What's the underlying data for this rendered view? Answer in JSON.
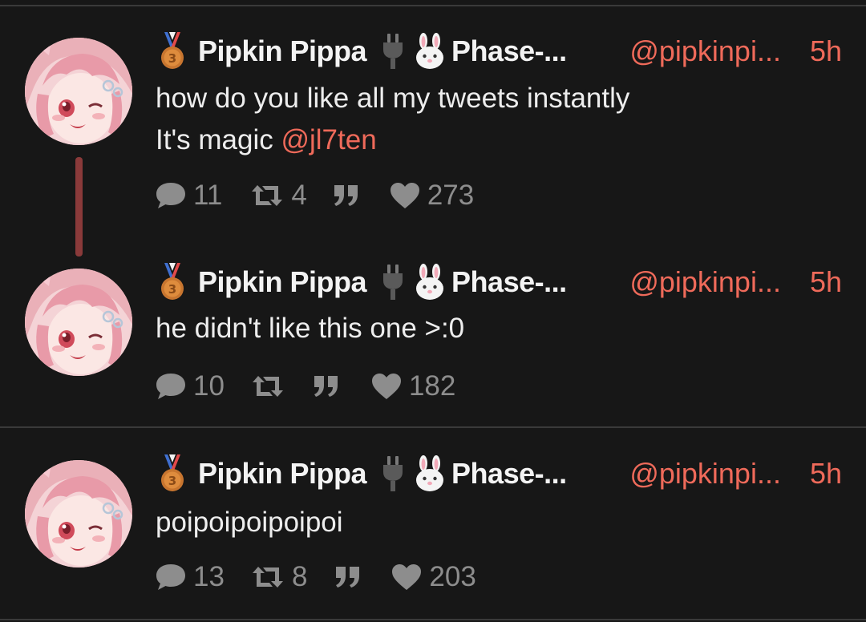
{
  "posts": [
    {
      "author_name": "Pipkin Pippa",
      "author_suffix": "Phase-...",
      "handle": "@pipkinpi...",
      "time": "5h",
      "text_line1": "how do you like all my tweets instantly",
      "text_line2_prefix": "It's magic ",
      "mention": "@jl7ten",
      "replies": "11",
      "retweets": "4",
      "likes": "273"
    },
    {
      "author_name": "Pipkin Pippa",
      "author_suffix": "Phase-...",
      "handle": "@pipkinpi...",
      "time": "5h",
      "text_line1": "he didn't like this one >:0",
      "replies": "10",
      "retweets": "",
      "likes": "182"
    },
    {
      "author_name": "Pipkin Pippa",
      "author_suffix": "Phase-...",
      "handle": "@pipkinpi...",
      "time": "5h",
      "text_line1": "poipoipoipoipoi",
      "replies": "13",
      "retweets": "8",
      "likes": "203"
    }
  ],
  "colors": {
    "background": "#171717",
    "accent": "#ef6a5a",
    "thread_line": "#8a3a3a",
    "muted": "#8d8d8d"
  },
  "icons": {
    "badge": "third-place-medal-icon",
    "emoji1": "electric-plug-icon",
    "emoji2": "rabbit-face-icon",
    "reply": "speech-bubble-icon",
    "retweet": "retweet-icon",
    "quote": "quote-icon",
    "like": "heart-icon"
  }
}
